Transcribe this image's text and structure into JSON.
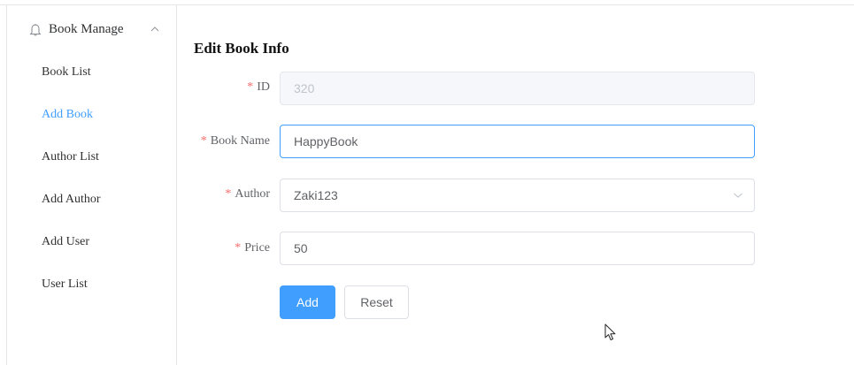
{
  "sidebar": {
    "menu_title": "Book Manage",
    "menu_icon": "bell-icon",
    "items": [
      {
        "label": "Book List",
        "active": false
      },
      {
        "label": "Add Book",
        "active": true
      },
      {
        "label": "Author List",
        "active": false
      },
      {
        "label": "Add Author",
        "active": false
      },
      {
        "label": "Add User",
        "active": false
      },
      {
        "label": "User List",
        "active": false
      }
    ]
  },
  "form": {
    "title": "Edit Book Info",
    "required_mark": "*",
    "fields": {
      "id": {
        "label": "ID",
        "value": "320",
        "disabled": true
      },
      "book_name": {
        "label": "Book Name",
        "value": "HappyBook"
      },
      "author": {
        "label": "Author",
        "value": "Zaki123"
      },
      "price": {
        "label": "Price",
        "value": "50"
      }
    },
    "add_label": "Add",
    "reset_label": "Reset"
  },
  "colors": {
    "accent": "#409eff",
    "required": "#f56c6c",
    "disabled_bg": "#f5f7fa"
  }
}
